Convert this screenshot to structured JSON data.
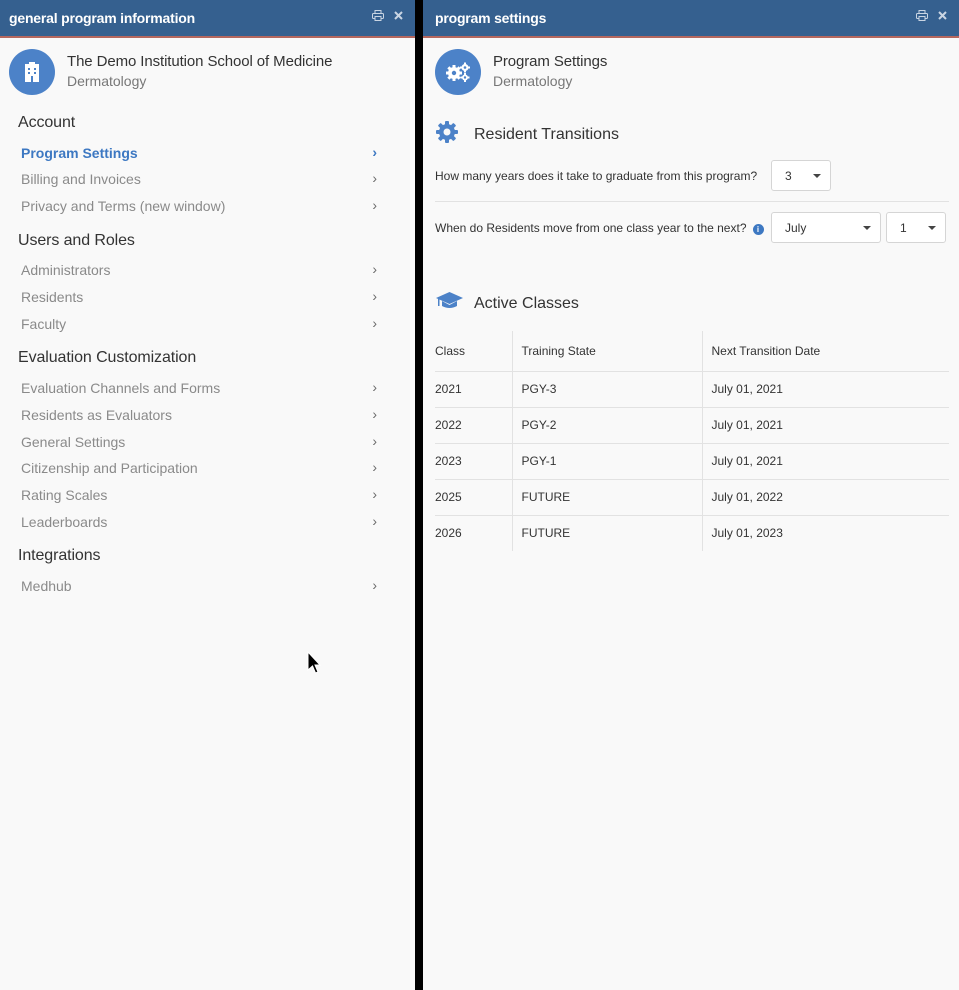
{
  "left": {
    "title": "general program information",
    "header": {
      "title": "The Demo Institution School of Medicine",
      "subtitle": "Dermatology",
      "icon": "building-icon"
    },
    "sections": [
      {
        "title": "Account",
        "items": [
          "Program Settings",
          "Billing and Invoices",
          "Privacy and Terms (new window)"
        ]
      },
      {
        "title": "Users and Roles",
        "items": [
          "Administrators",
          "Residents",
          "Faculty"
        ]
      },
      {
        "title": "Evaluation Customization",
        "items": [
          "Evaluation Channels and Forms",
          "Residents as Evaluators",
          "General Settings",
          "Citizenship and Participation",
          "Rating Scales",
          "Leaderboards"
        ]
      },
      {
        "title": "Integrations",
        "items": [
          "Medhub"
        ]
      }
    ],
    "active_item": "Program Settings"
  },
  "right": {
    "title": "program settings",
    "header": {
      "title": "Program Settings",
      "subtitle": "Dermatology",
      "icon": "gears-icon"
    },
    "resident_transitions": {
      "title": "Resident Transitions",
      "q1": {
        "label": "How many years does it take to graduate from this program?",
        "value": "3"
      },
      "q2": {
        "label": "When do Residents move from one class year to the next?",
        "month": "July",
        "day": "1"
      }
    },
    "active_classes": {
      "title": "Active Classes",
      "columns": [
        "Class",
        "Training State",
        "Next Transition Date"
      ],
      "rows": [
        [
          "2021",
          "PGY-3",
          "July 01, 2021"
        ],
        [
          "2022",
          "PGY-2",
          "July 01, 2021"
        ],
        [
          "2023",
          "PGY-1",
          "July 01, 2021"
        ],
        [
          "2025",
          "FUTURE",
          "July 01, 2022"
        ],
        [
          "2026",
          "FUTURE",
          "July 01, 2023"
        ]
      ]
    }
  },
  "colors": {
    "titlebar": "#35608f",
    "accent": "#3d78c2",
    "avatar": "#4c82c8"
  }
}
